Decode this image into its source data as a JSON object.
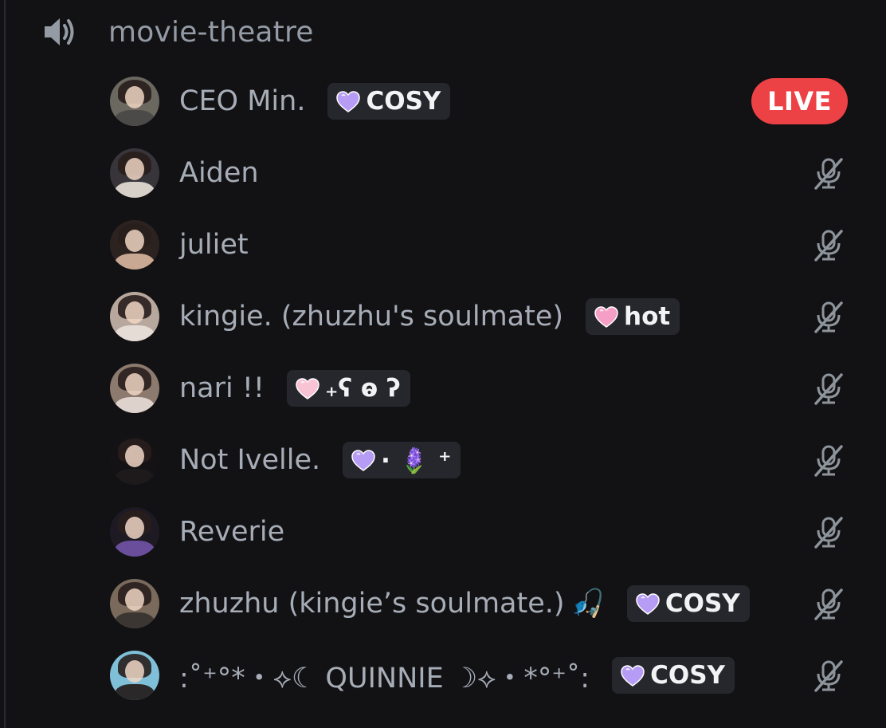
{
  "channel": {
    "name": "movie-theatre",
    "icon": "speaker-icon"
  },
  "live_label": "LIVE",
  "users": [
    {
      "name": "CEO Min.",
      "extra": "",
      "tag": {
        "text": "COSY",
        "heart": "#b69cf5"
      },
      "live": true,
      "muted": false,
      "avatar": [
        "#4c4a48",
        "#6b6860"
      ]
    },
    {
      "name": "Aiden",
      "extra": "",
      "tag": null,
      "live": false,
      "muted": true,
      "avatar": [
        "#d6d0c8",
        "#38353a"
      ]
    },
    {
      "name": "juliet",
      "extra": "",
      "tag": null,
      "live": false,
      "muted": true,
      "avatar": [
        "#c8a892",
        "#2c2320"
      ]
    },
    {
      "name": "kingie. (zhuzhu's soulmate)",
      "extra": "",
      "tag": {
        "text": "hot",
        "heart": "#f59ec6"
      },
      "live": false,
      "muted": true,
      "avatar": [
        "#e6dcd6",
        "#b8a79c"
      ]
    },
    {
      "name": "nari !!",
      "extra": "",
      "tag": {
        "text": "₊ʕ ⱺ ʔ",
        "heart": "#f8c3d4"
      },
      "live": false,
      "muted": true,
      "avatar": [
        "#ddd2cc",
        "#8c7a6e"
      ]
    },
    {
      "name": "Not Ivelle.",
      "extra": "",
      "tag": {
        "text": "⋅ 🪻 ⁺",
        "heart": "#b69cf5"
      },
      "live": false,
      "muted": true,
      "avatar": [
        "#1e1a1c",
        "#141214"
      ]
    },
    {
      "name": "Reverie",
      "extra": "",
      "tag": null,
      "live": false,
      "muted": true,
      "avatar": [
        "#6a4e9c",
        "#1e1a24"
      ]
    },
    {
      "name": "zhuzhu (kingie’s soulmate.)",
      "extra": "🎣",
      "tag": {
        "text": "COSY",
        "heart": "#b69cf5"
      },
      "live": false,
      "muted": true,
      "avatar": [
        "#3c3632",
        "#7a6a5c"
      ]
    },
    {
      "name": ":˚⁺°*・⟡☾   QUINNIE   ☽⟡・*°⁺˚:",
      "extra": "",
      "tag": {
        "text": "COSY",
        "heart": "#b69cf5"
      },
      "live": false,
      "muted": true,
      "avatar": [
        "#2a2828",
        "#7fc0d8"
      ]
    }
  ],
  "colors": {
    "background": "#121215",
    "text_muted": "#a7adb7",
    "live_red": "#ed4245",
    "tag_bg": "#26272d"
  }
}
